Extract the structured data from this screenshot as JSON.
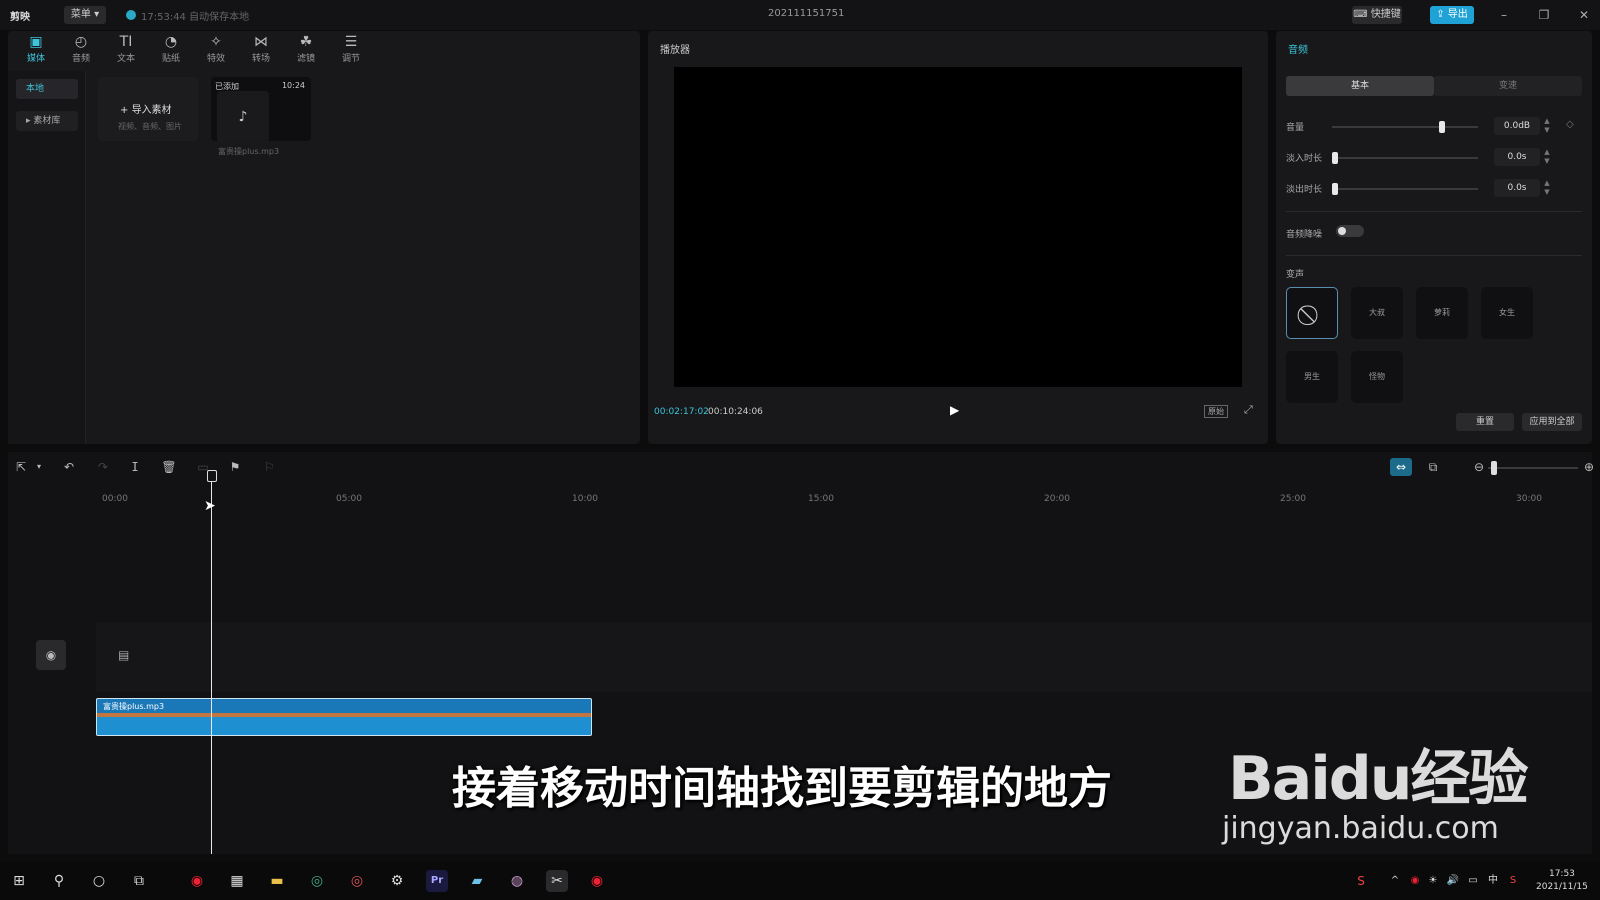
{
  "titlebar": {
    "app_name": "剪映",
    "menu_label": "菜单",
    "autosave": "17:53:44 自动保存本地",
    "project_name": "202111151751",
    "shortcut_label": "快捷键",
    "export_label": "导出"
  },
  "media": {
    "tools": [
      {
        "label": "媒体",
        "icon": "media-icon"
      },
      {
        "label": "音频",
        "icon": "audio-icon"
      },
      {
        "label": "文本",
        "icon": "text-icon"
      },
      {
        "label": "贴纸",
        "icon": "sticker-icon"
      },
      {
        "label": "特效",
        "icon": "effect-icon"
      },
      {
        "label": "转场",
        "icon": "transition-icon"
      },
      {
        "label": "滤镜",
        "icon": "filter-icon"
      },
      {
        "label": "调节",
        "icon": "adjust-icon"
      }
    ],
    "side_local": "本地",
    "side_library": "素材库",
    "import_label": "导入素材",
    "import_hint": "视频、音频、图片",
    "clip_added": "已添加",
    "clip_duration": "10:24",
    "clip_name": "富贵操plus.mp3"
  },
  "player": {
    "title": "播放器",
    "current_time": "00:02:17:02",
    "total_time": "00:10:24:06",
    "ratio_label": "原始"
  },
  "props": {
    "title": "音频",
    "tab_basic": "基本",
    "tab_speed": "变速",
    "volume_label": "音量",
    "volume_value": "0.0dB",
    "fadein_label": "淡入时长",
    "fadein_value": "0.0s",
    "fadeout_label": "淡出时长",
    "fadeout_value": "0.0s",
    "denoise_label": "音频降噪",
    "voice_label": "变声",
    "voices": [
      "大叔",
      "萝莉",
      "女生",
      "男生",
      "怪物"
    ],
    "reset_label": "重置",
    "apply_all_label": "应用到全部"
  },
  "timeline": {
    "ruler": [
      "00:00",
      "05:00",
      "10:00",
      "15:00",
      "20:00",
      "25:00",
      "30:00"
    ],
    "audio_clip_name": "富贵操plus.mp3"
  },
  "subtitle": "接着移动时间轴找到要剪辑的地方",
  "watermark": {
    "brand": "Baidu经验",
    "url": "jingyan.baidu.com"
  },
  "taskbar": {
    "time": "17:53",
    "date": "2021/11/15",
    "ime": "中"
  }
}
